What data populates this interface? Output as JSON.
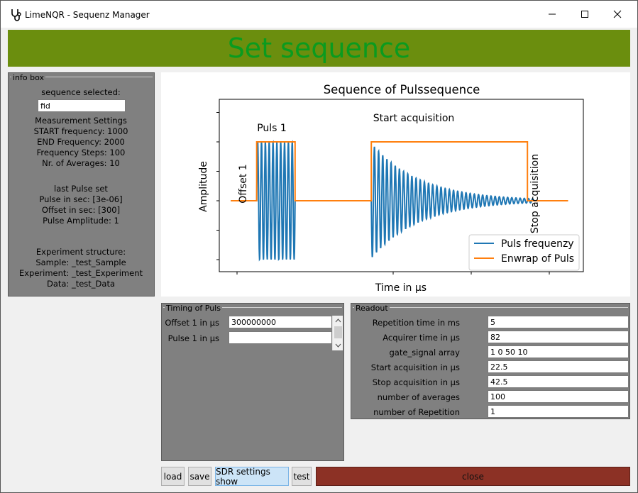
{
  "window": {
    "title": "LimeNQR - Sequenz Manager",
    "icon": "stethoscope-icon",
    "controls": [
      "minimize-icon",
      "maximize-icon",
      "close-icon"
    ]
  },
  "banner": {
    "text": "Set sequence",
    "bg": "#6b8e0e",
    "fg": "#0a9b1f"
  },
  "info_box": {
    "title": "info box",
    "sequence_selected_label": "sequence selected:",
    "sequence_value": "fid",
    "measurement_header": "Measurement Settings",
    "start_frequency": "START frequency: 1000",
    "end_frequency": "END Frequency: 2000",
    "frequency_steps": "Frequency Steps: 100",
    "averages": "Nr. of Averages: 10",
    "last_pulse_header": "last Pulse set",
    "pulse_in_sec": "Pulse in sec: [3e-06]",
    "offset_in_sec": "Offset in sec: [300]",
    "pulse_amplitude": "Pulse Amplitude: 1",
    "experiment_header": "Experiment structure:",
    "sample": "Sample: _test_Sample",
    "experiment": "Experiment: _test_Experiment",
    "data": "Data: _test_Data"
  },
  "chart": {
    "title": "Sequence of Pulssequence",
    "xlabel": "Time in µs",
    "ylabel": "Amplitude",
    "annotations": {
      "offset": "Offset 1",
      "pulse": "Puls 1",
      "start": "Start acquisition",
      "stop": "Stop acquisition"
    },
    "legend": {
      "puls": "Puls frequenzy",
      "envelope": "Enwrap of Puls"
    },
    "colors": {
      "puls": "#1f77b4",
      "envelope": "#ff7f0e"
    }
  },
  "chart_data": {
    "type": "line",
    "title": "Sequence of Pulssequence",
    "xlabel": "Time in µs",
    "ylabel": "Amplitude",
    "legend_position": "bottom-right",
    "series": [
      {
        "name": "Puls frequenzy",
        "description": "sinusoid bursts: pulse at x 0.26-0.4, decaying FID from x 0.5-0.95"
      },
      {
        "name": "Enwrap of Puls",
        "x": [
          0,
          0.26,
          0.26,
          0.4,
          0.4,
          0.5,
          0.5,
          0.95,
          0.95,
          1.06
        ],
        "y": [
          0,
          0,
          1,
          1,
          0,
          0,
          1,
          1,
          0,
          0
        ]
      }
    ]
  },
  "timing": {
    "title": "Timing of Puls",
    "offset_label": "Offset 1 in µs",
    "offset_value": "300000000",
    "pulse_label": "Pulse 1 in µs",
    "pulse_value": ""
  },
  "readout": {
    "title": "Readout",
    "rows": [
      {
        "label": "Repetition time in ms",
        "value": "5"
      },
      {
        "label": "Acquirer time in µs",
        "value": "82"
      },
      {
        "label": "gate_signal array",
        "value": "1 0 50 10"
      },
      {
        "label": "Start acquisition in µs",
        "value": "22.5"
      },
      {
        "label": "Stop acquisition in µs",
        "value": "42.5"
      },
      {
        "label": "number of averages",
        "value": "100"
      },
      {
        "label": "number of Repetition",
        "value": "1"
      }
    ]
  },
  "buttons": {
    "load": "load",
    "save": "save",
    "sdr": "SDR settings show",
    "test": "test",
    "close": "close"
  }
}
